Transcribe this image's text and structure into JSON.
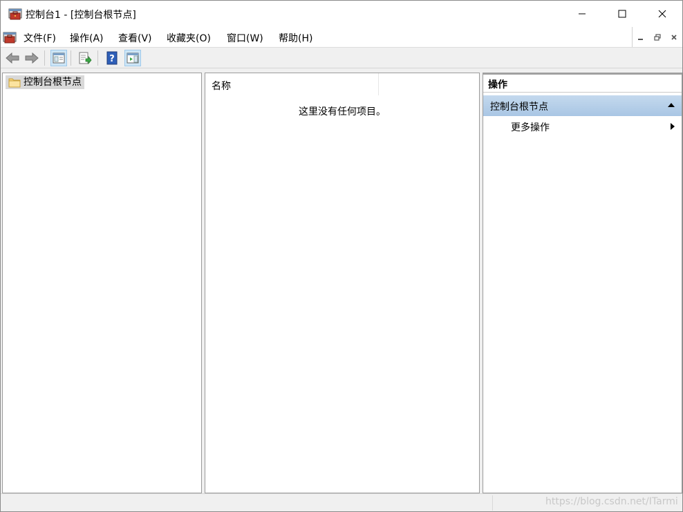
{
  "window": {
    "title": "控制台1 - [控制台根节点]"
  },
  "menubar": {
    "items": [
      "文件(F)",
      "操作(A)",
      "查看(V)",
      "收藏夹(O)",
      "窗口(W)",
      "帮助(H)"
    ]
  },
  "tree": {
    "root_label": "控制台根节点"
  },
  "list": {
    "column_name": "名称",
    "empty_message": "这里没有任何项目。"
  },
  "actions": {
    "title": "操作",
    "section_label": "控制台根节点",
    "more_label": "更多操作"
  },
  "statusbar": {
    "watermark": "https://blog.csdn.net/ITarmi"
  },
  "colors": {
    "section_bg": "#b7cfe9",
    "pressed_bg": "#cde6f7",
    "folder": "#f5d27a"
  },
  "icons": {
    "app": "toolbox-icon",
    "back": "arrow-left-icon",
    "forward": "arrow-right-icon",
    "show_tree": "console-tree-icon",
    "export": "export-list-icon",
    "help": "help-icon",
    "action_pane": "action-pane-icon"
  }
}
